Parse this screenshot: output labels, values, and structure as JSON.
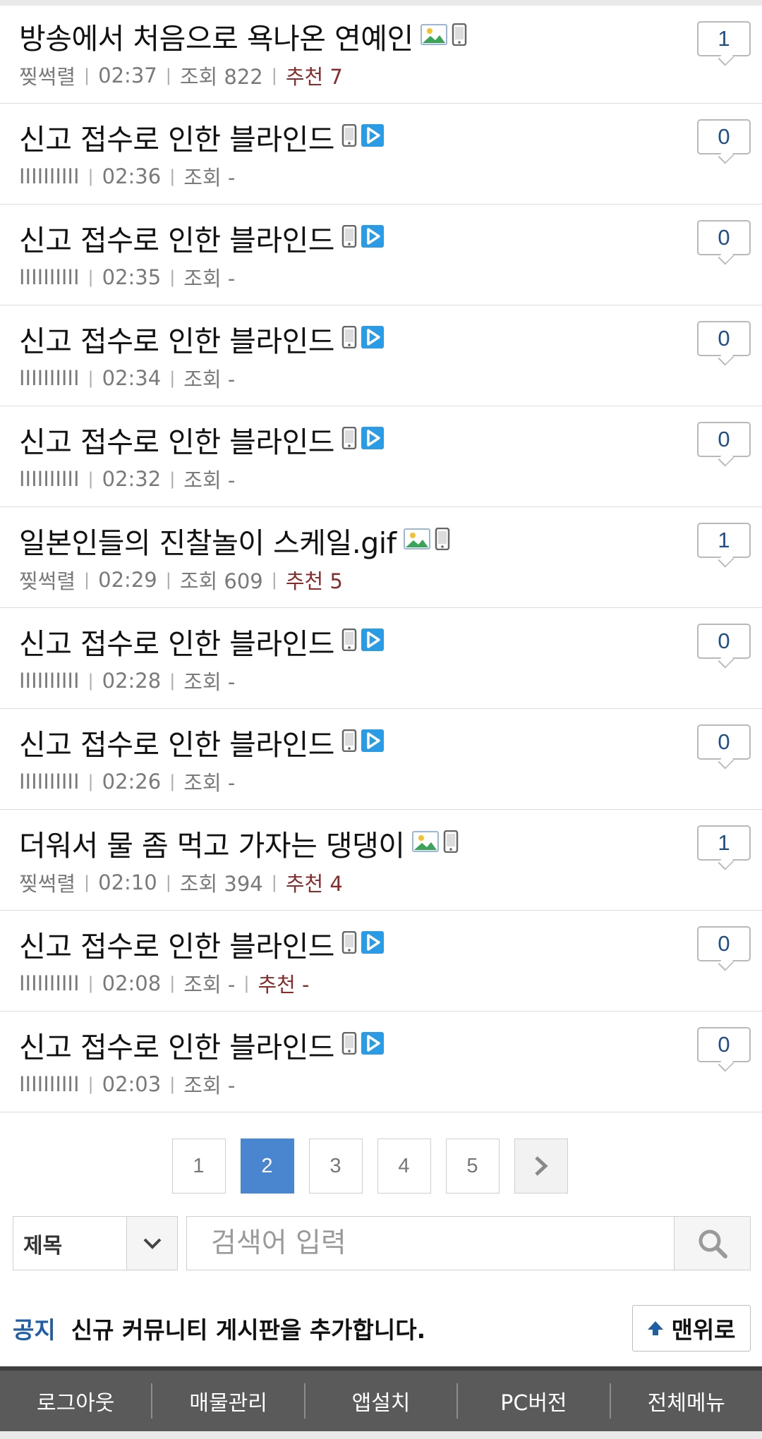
{
  "posts": [
    {
      "title": "방송에서 처음으로 욕나온 연예인",
      "author": "찢썩렬",
      "time": "02:37",
      "views_label": "조회 822",
      "rec_label": "추천 7",
      "comments": "1",
      "icons": [
        "image-icon",
        "mobile-icon"
      ]
    },
    {
      "title": "신고 접수로 인한 블라인드",
      "author": "IIIIIIIIII",
      "time": "02:36",
      "views_label": "조회 -",
      "rec_label": "",
      "comments": "0",
      "icons": [
        "mobile-icon",
        "video-icon"
      ]
    },
    {
      "title": "신고 접수로 인한 블라인드",
      "author": "IIIIIIIIII",
      "time": "02:35",
      "views_label": "조회 -",
      "rec_label": "",
      "comments": "0",
      "icons": [
        "mobile-icon",
        "video-icon"
      ]
    },
    {
      "title": "신고 접수로 인한 블라인드",
      "author": "IIIIIIIIII",
      "time": "02:34",
      "views_label": "조회 -",
      "rec_label": "",
      "comments": "0",
      "icons": [
        "mobile-icon",
        "video-icon"
      ]
    },
    {
      "title": "신고 접수로 인한 블라인드",
      "author": "IIIIIIIIII",
      "time": "02:32",
      "views_label": "조회 -",
      "rec_label": "",
      "comments": "0",
      "icons": [
        "mobile-icon",
        "video-icon"
      ]
    },
    {
      "title": "일본인들의 진찰놀이 스케일.gif",
      "author": "찢썩렬",
      "time": "02:29",
      "views_label": "조회 609",
      "rec_label": "추천 5",
      "comments": "1",
      "icons": [
        "image-icon",
        "mobile-icon"
      ]
    },
    {
      "title": "신고 접수로 인한 블라인드",
      "author": "IIIIIIIIII",
      "time": "02:28",
      "views_label": "조회 -",
      "rec_label": "",
      "comments": "0",
      "icons": [
        "mobile-icon",
        "video-icon"
      ]
    },
    {
      "title": "신고 접수로 인한 블라인드",
      "author": "IIIIIIIIII",
      "time": "02:26",
      "views_label": "조회 -",
      "rec_label": "",
      "comments": "0",
      "icons": [
        "mobile-icon",
        "video-icon"
      ]
    },
    {
      "title": "더워서 물 좀 먹고 가자는 댕댕이",
      "author": "찢썩렬",
      "time": "02:10",
      "views_label": "조회 394",
      "rec_label": "추천 4",
      "comments": "1",
      "icons": [
        "image-icon",
        "mobile-icon"
      ]
    },
    {
      "title": "신고 접수로 인한 블라인드",
      "author": "IIIIIIIIII",
      "time": "02:08",
      "views_label": "조회 -",
      "rec_label": "추천 -",
      "comments": "0",
      "icons": [
        "mobile-icon",
        "video-icon"
      ]
    },
    {
      "title": "신고 접수로 인한 블라인드",
      "author": "IIIIIIIIII",
      "time": "02:03",
      "views_label": "조회 -",
      "rec_label": "",
      "comments": "0",
      "icons": [
        "mobile-icon",
        "video-icon"
      ]
    }
  ],
  "pagination": {
    "pages": [
      "1",
      "2",
      "3",
      "4",
      "5"
    ],
    "current": "2",
    "next_icon": "chevron-right-icon"
  },
  "search": {
    "field_label": "제목",
    "placeholder": "검색어 입력",
    "dropdown_icon": "chevron-down-icon",
    "button_icon": "search-icon"
  },
  "notice": {
    "tag": "공지",
    "text": "신규 커뮤니티 게시판을 추가합니다.",
    "top_button": "맨위로"
  },
  "bottom_nav": [
    "로그아웃",
    "매물관리",
    "앱설치",
    "PC버전",
    "전체메뉴"
  ],
  "colors": {
    "accent": "#4a85d0",
    "recommend": "#8b2a2a",
    "notice": "#1e5fa8",
    "comment_count": "#1f4f86",
    "nav_bg": "#5a5a5a"
  }
}
